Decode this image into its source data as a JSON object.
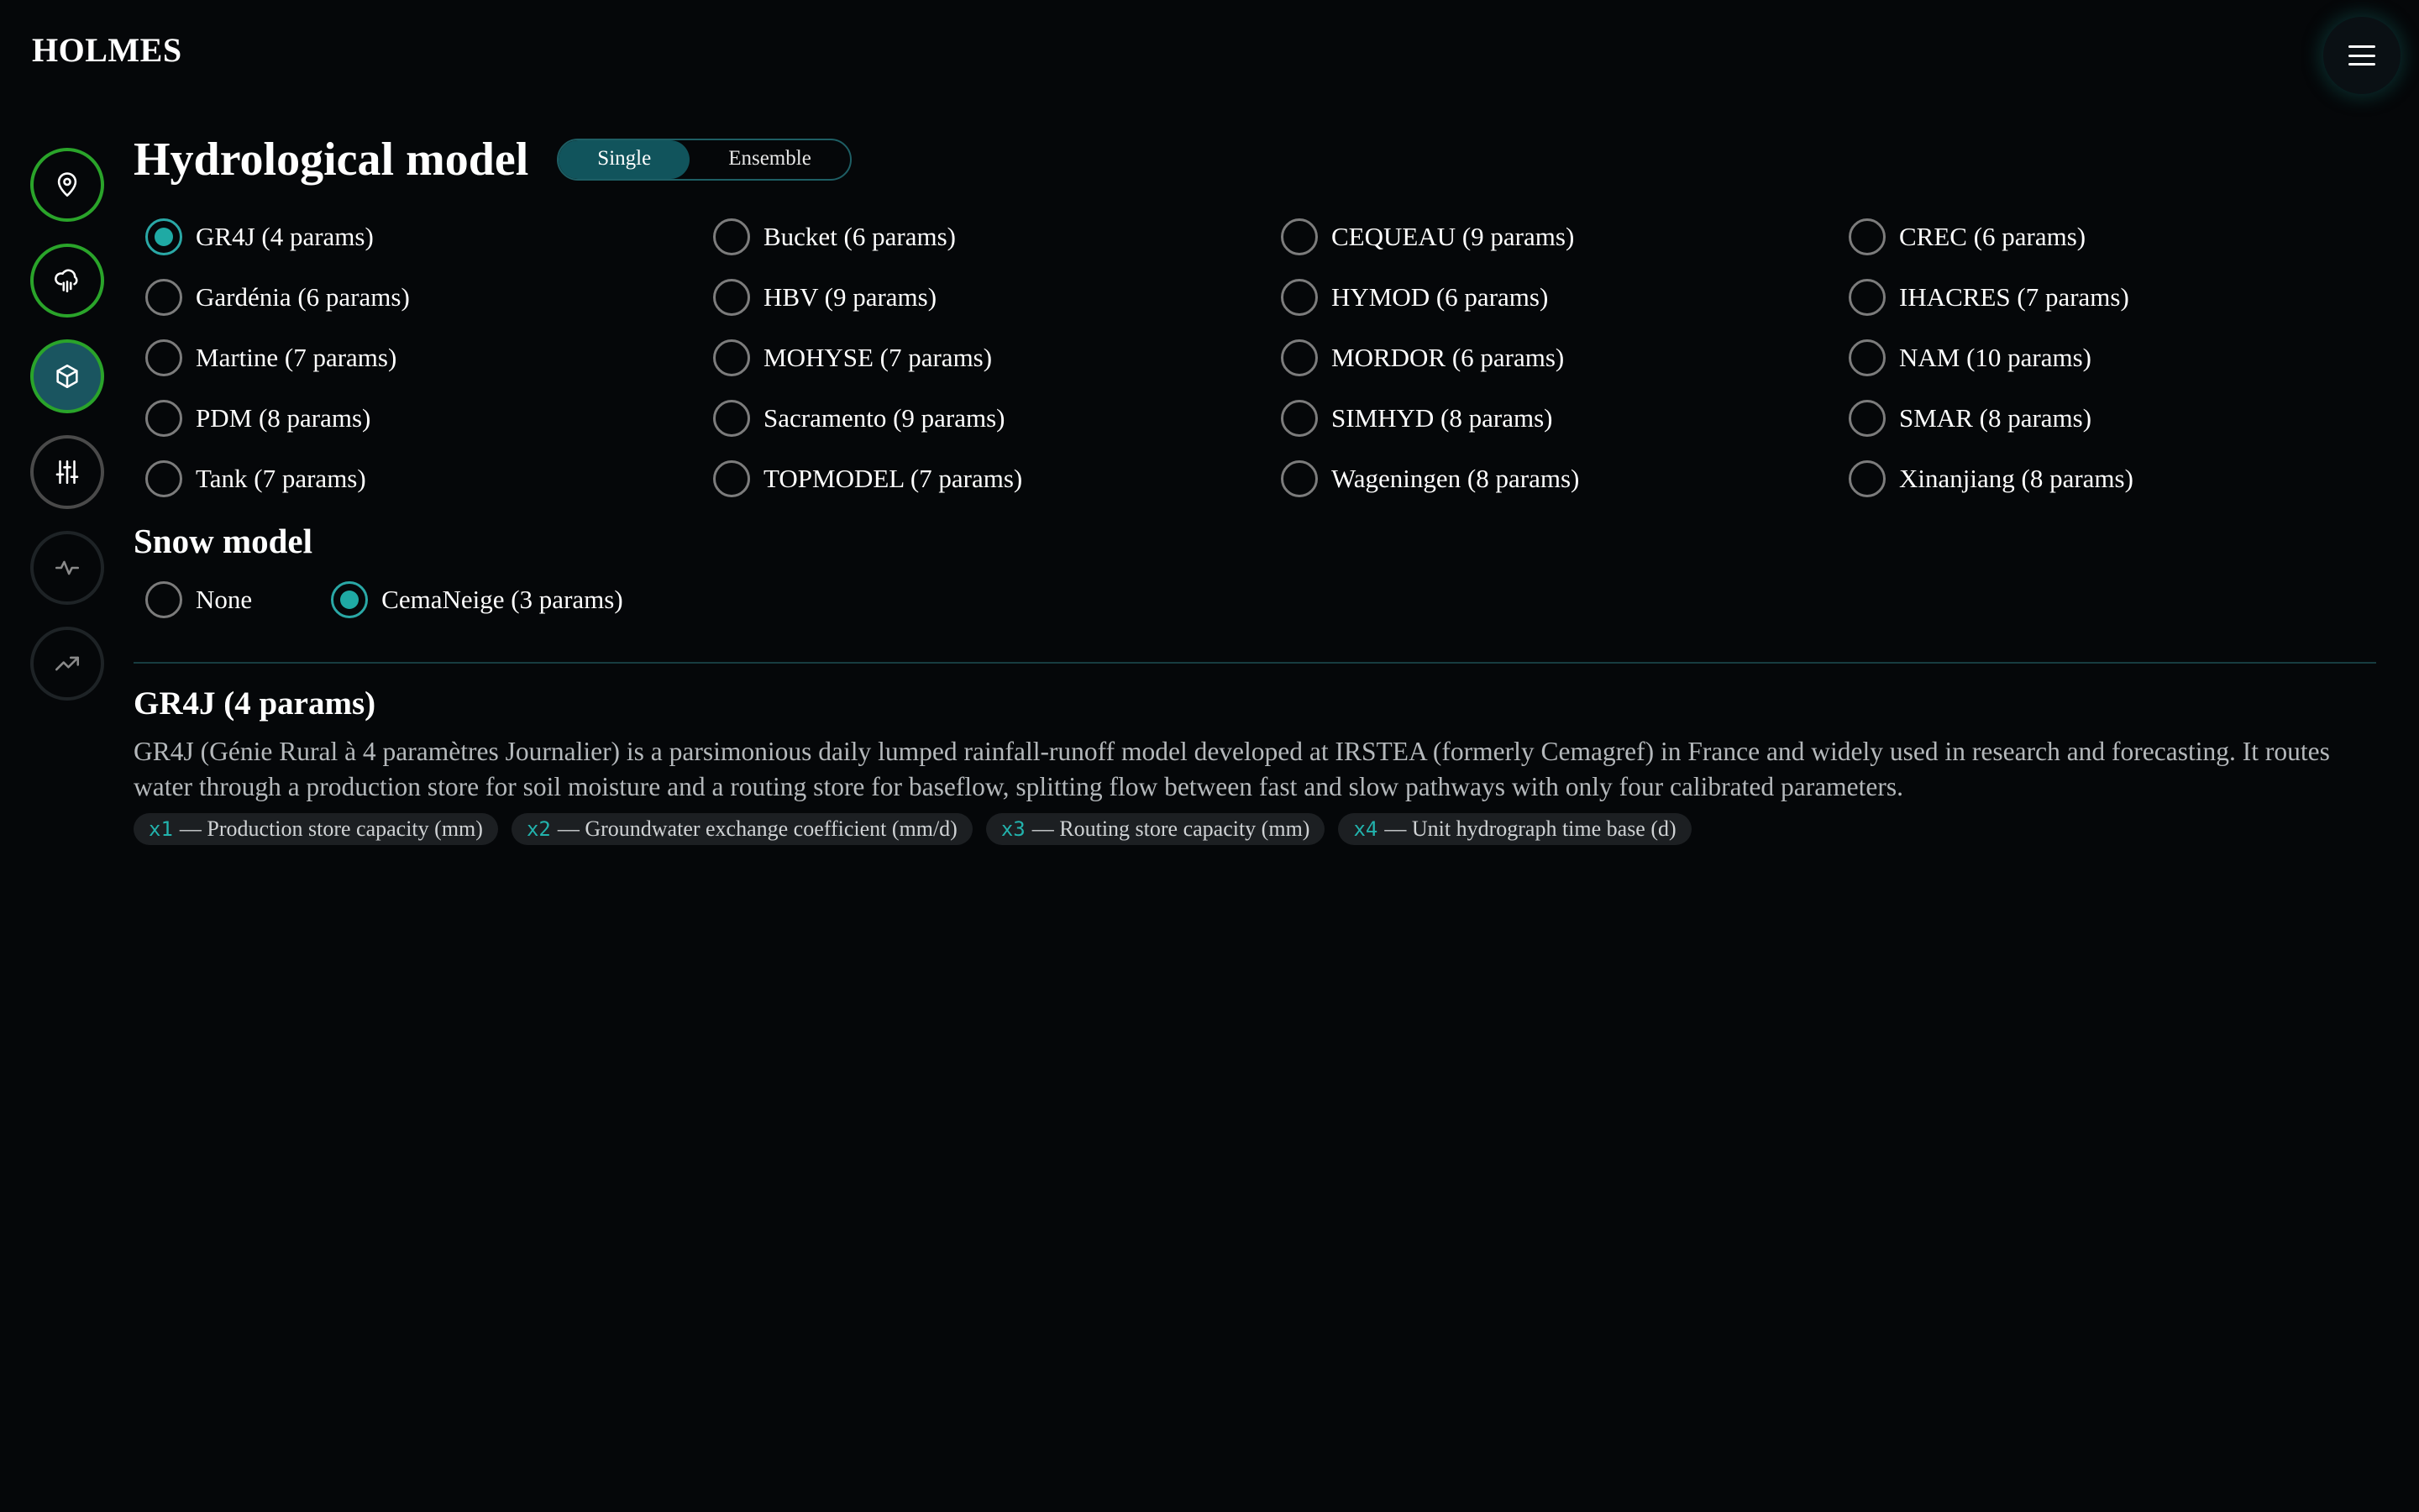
{
  "app": {
    "brand": "HOLMES"
  },
  "colors": {
    "accent": "#1faaa4",
    "done": "#2aa42a",
    "background": "#050709"
  },
  "rail": [
    {
      "icon": "map-pin-icon",
      "state": "done"
    },
    {
      "icon": "cloud-rain-icon",
      "state": "done"
    },
    {
      "icon": "cube-icon",
      "state": "active"
    },
    {
      "icon": "sliders-icon",
      "state": "current"
    },
    {
      "icon": "pulse-icon",
      "state": "dim"
    },
    {
      "icon": "trending-up-icon",
      "state": "dim"
    }
  ],
  "hydro": {
    "title": "Hydrological model",
    "toggle": {
      "single": "Single",
      "ensemble": "Ensemble",
      "selected": "Single"
    },
    "selected": "GR4J (4 params)",
    "models": [
      "GR4J (4 params)",
      "Bucket (6 params)",
      "CEQUEAU (9 params)",
      "CREC (6 params)",
      "Gardénia (6 params)",
      "HBV (9 params)",
      "HYMOD (6 params)",
      "IHACRES (7 params)",
      "Martine (7 params)",
      "MOHYSE (7 params)",
      "MORDOR (6 params)",
      "NAM (10 params)",
      "PDM (8 params)",
      "Sacramento (9 params)",
      "SIMHYD (8 params)",
      "SMAR (8 params)",
      "Tank (7 params)",
      "TOPMODEL (7 params)",
      "Wageningen (8 params)",
      "Xinanjiang (8 params)"
    ]
  },
  "snow": {
    "title": "Snow model",
    "selected": "CemaNeige (3 params)",
    "options": [
      "None",
      "CemaNeige (3 params)"
    ]
  },
  "detail": {
    "title": "GR4J (4 params)",
    "description": "GR4J (Génie Rural à 4 paramètres Journalier) is a parsimonious daily lumped rainfall-runoff model developed at IRSTEA (formerly Cemagref) in France and widely used in research and forecasting. It routes water through a production store for soil moisture and a routing store for baseflow, splitting flow between fast and slow pathways with only four calibrated parameters.",
    "params": [
      {
        "code": "x1",
        "text": "— Production store capacity (mm)"
      },
      {
        "code": "x2",
        "text": "— Groundwater exchange coefficient (mm/d)"
      },
      {
        "code": "x3",
        "text": "— Routing store capacity (mm)"
      },
      {
        "code": "x4",
        "text": "— Unit hydrograph time base (d)"
      }
    ]
  }
}
